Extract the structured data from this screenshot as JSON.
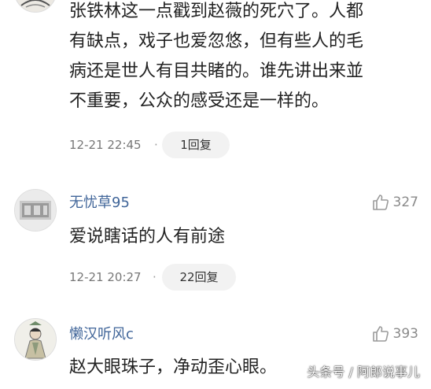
{
  "comments": [
    {
      "lines": [
        "张铁林这一点戳到赵薇的死穴了。人都",
        "有缺点，戏子也爱忽悠，但有些人的毛",
        "病还是世人有目共睹的。谁先讲出来並",
        "不重要，公众的感受还是一样的。"
      ],
      "time": "12-21 22:45",
      "separator": "·",
      "reply": "1回复"
    },
    {
      "username": "无忧草95",
      "likes": "327",
      "lines": [
        "爱说瞎话的人有前途"
      ],
      "time": "12-21 20:27",
      "separator": "·",
      "reply": "22回复"
    },
    {
      "username": "懒汉听风c",
      "likes": "393",
      "lines": [
        "赵大眼珠子，净动歪心眼。"
      ]
    }
  ],
  "watermark": "头条号 / 阿郎说事儿",
  "icons": {
    "like": "thumbs-up-icon"
  },
  "colors": {
    "username": "#406599",
    "muted": "#777777",
    "pill_bg": "#f2f2f2"
  }
}
